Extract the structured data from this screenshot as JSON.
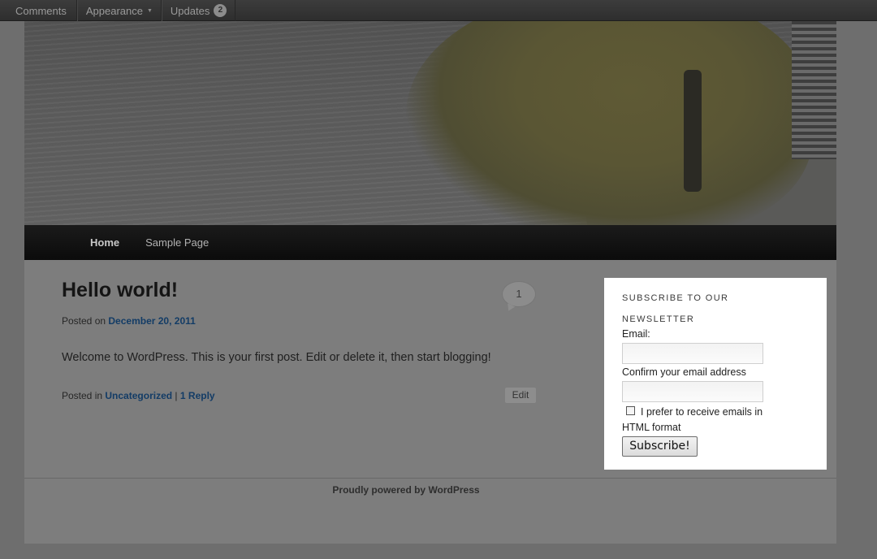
{
  "adminbar": {
    "comments": "Comments",
    "appearance": "Appearance",
    "updates": "Updates",
    "updates_count": "2"
  },
  "nav": {
    "items": [
      "Home",
      "Sample Page"
    ]
  },
  "post": {
    "title": "Hello world!",
    "comment_count": "1",
    "posted_on": "Posted on",
    "date": "December 20, 2011",
    "body": "Welcome to WordPress. This is your first post. Edit or delete it, then start blogging!",
    "posted_in": "Posted in",
    "category": "Uncategorized",
    "separator": "|",
    "reply_count": "1",
    "reply_label": "Reply",
    "edit_label": "Edit"
  },
  "widget": {
    "title": "SUBSCRIBE TO OUR NEWSLETTER",
    "email_label": "Email:",
    "email_value": "",
    "confirm_label": "Confirm your email address",
    "confirm_value": "",
    "html_pref_label": "I prefer to receive emails in HTML format",
    "html_pref_checked": false,
    "subscribe_label": "Subscribe!"
  },
  "footer": {
    "text": "Proudly powered by WordPress"
  }
}
